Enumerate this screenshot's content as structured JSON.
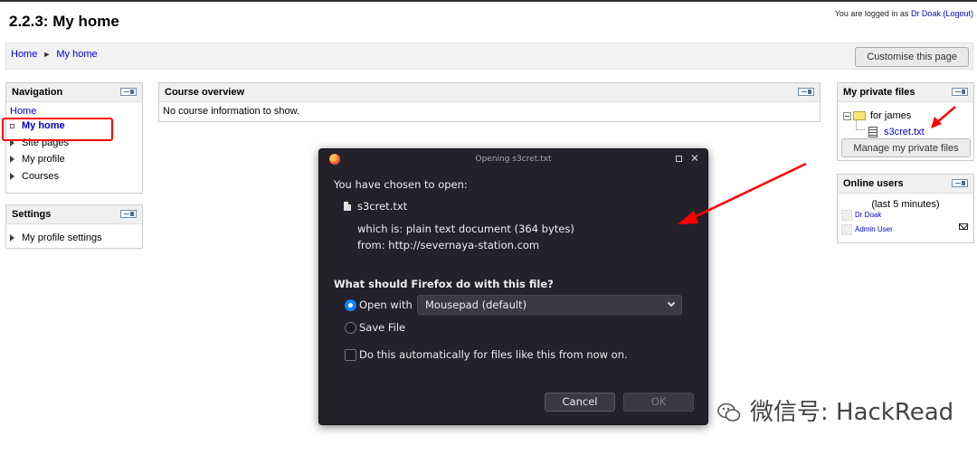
{
  "header": {
    "title": "2.2.3: My home",
    "login_prefix": "You are logged in as",
    "login_user": "Dr Doak",
    "logout": "(Logout)"
  },
  "breadcrumb": {
    "home": "Home",
    "separator": "►",
    "current": "My home"
  },
  "customise_button": "Customise this page",
  "navigation": {
    "title": "Navigation",
    "home": "Home",
    "items": [
      "My home",
      "Site pages",
      "My profile",
      "Courses"
    ]
  },
  "settings": {
    "title": "Settings",
    "items": [
      "My profile settings"
    ]
  },
  "course_overview": {
    "title": "Course overview",
    "message": "No course information to show."
  },
  "private_files": {
    "title": "My private files",
    "folder": "for james",
    "file": "s3cret.txt",
    "manage_button": "Manage my private files"
  },
  "online_users": {
    "title": "Online users",
    "subtitle": "(last 5 minutes)",
    "users": [
      "Dr Doak",
      "Admin User"
    ]
  },
  "dialog": {
    "title": "Opening s3cret.txt",
    "intro": "You have chosen to open:",
    "filename": "s3cret.txt",
    "which_is": "which is:  plain text document (364 bytes)",
    "from": "from:  http://severnaya-station.com",
    "question": "What should Firefox do with this file?",
    "open_with_label": "Open with",
    "open_with_value": "Mousepad (default)",
    "save_file_label": "Save File",
    "auto_label": "Do this automatically for files like this from now on.",
    "cancel": "Cancel",
    "ok": "OK",
    "selected_option": "open_with"
  },
  "watermark": {
    "text": "微信号: HackRead"
  },
  "colors": {
    "annotation_red": "#ff0000",
    "link": "#0000cc",
    "dialog_bg": "#23222b",
    "accent": "#0a84ff"
  },
  "icons": [
    "firefox-icon",
    "maximize-icon",
    "close-icon",
    "file-icon",
    "folder-icon",
    "text-file-icon",
    "mail-icon",
    "chevron-down-icon",
    "wechat-logo"
  ]
}
